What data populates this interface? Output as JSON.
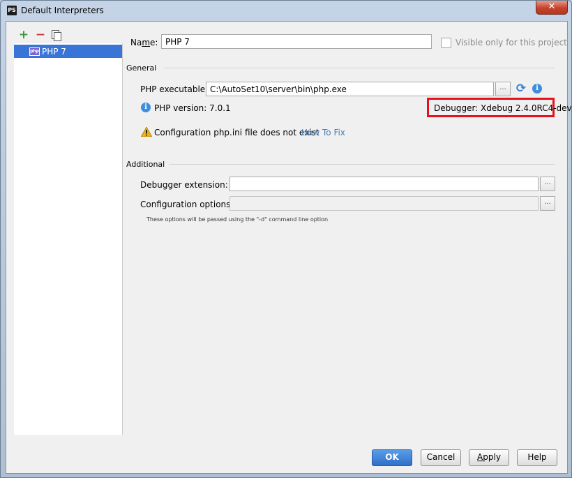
{
  "window": {
    "title": "Default Interpreters",
    "app_icon_text": "PS",
    "close_label": "✕"
  },
  "toolbar": {
    "add_label": "+",
    "remove_label": "−"
  },
  "tree": {
    "items": [
      {
        "label": "PHP 7",
        "icon_text": "php",
        "selected": true
      }
    ]
  },
  "form": {
    "name_label_pre": "Na",
    "name_label_mnemonic": "m",
    "name_label_post": "e:",
    "name_value": "PHP 7",
    "visible_only_label": "Visible only for this project",
    "visible_only_checked": false,
    "general_heading": "General",
    "php_executable_label": "PHP executable:",
    "php_executable_value": "C:\\AutoSet10\\server\\bin\\php.exe",
    "browse_label": "...",
    "php_version_text": "PHP version: 7.0.1",
    "debugger_text": "Debugger:  Xdebug 2.4.0RC4-dev",
    "config_warning_text": "Configuration php.ini file does not exist",
    "how_to_fix_label": "How To Fix",
    "additional_heading": "Additional",
    "debugger_extension_label": "Debugger extension:",
    "debugger_extension_value": "",
    "configuration_options_label": "Configuration options:",
    "configuration_options_value": "",
    "options_hint": "These options will be passed using the \"-d\" command line option"
  },
  "buttons": {
    "ok": "OK",
    "cancel": "Cancel",
    "apply_pre": "",
    "apply_mnemonic": "A",
    "apply_post": "pply",
    "help": "Help"
  },
  "colors": {
    "selection": "#3875d7",
    "ok_button": "#3b80d6",
    "highlight_border": "#e3131c",
    "link": "#4a7fb9"
  },
  "icons": [
    "php-icon",
    "info-icon",
    "refresh-icon",
    "warning-icon",
    "copy-icon",
    "close-icon"
  ]
}
